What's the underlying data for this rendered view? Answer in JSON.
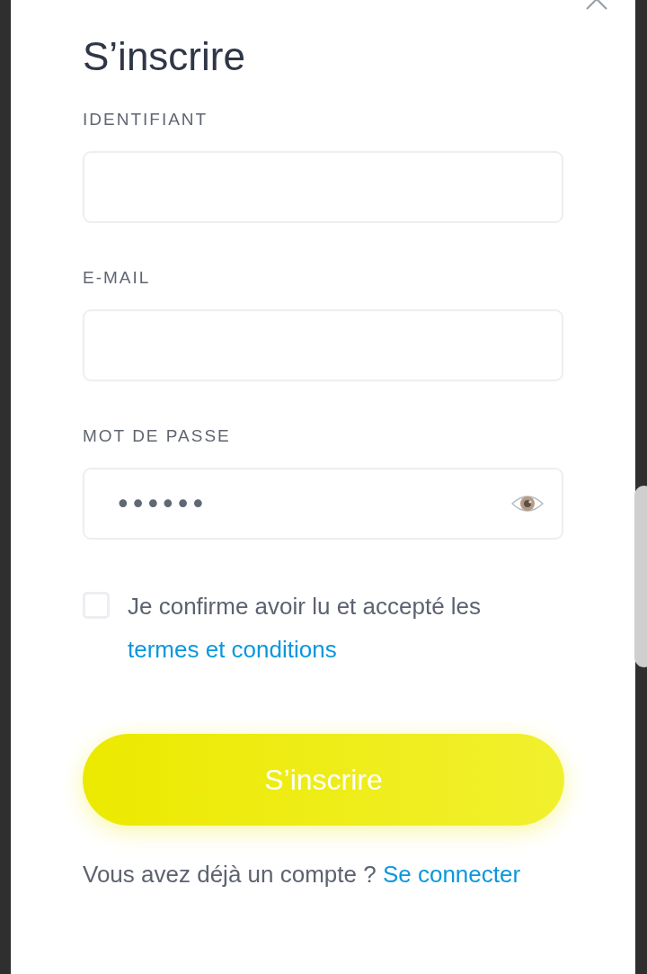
{
  "title": "S’inscrire",
  "fields": [
    {
      "label": "IDENTIFIANT",
      "kind": "text"
    },
    {
      "label": "E-MAIL",
      "kind": "text"
    },
    {
      "label": "MOT DE PASSE",
      "kind": "password",
      "value": "••••••"
    }
  ],
  "terms": {
    "checked": false,
    "text": "Je confirme avoir lu et accepté les",
    "link": "termes et conditions"
  },
  "submit": "S’inscrire",
  "login": {
    "text": "Vous avez déjà un compte ?",
    "link": "Se connecter"
  }
}
